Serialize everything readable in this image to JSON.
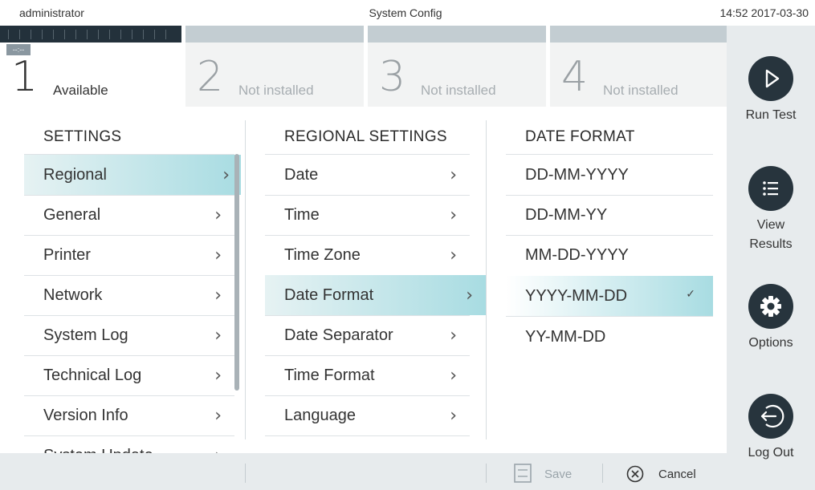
{
  "topbar": {
    "user": "administrator",
    "title": "System Config",
    "clock": "14:52 2017-03-30"
  },
  "modules": [
    {
      "number": "1",
      "status": "Available",
      "indicator": "--:--"
    },
    {
      "number": "2",
      "status": "Not installed"
    },
    {
      "number": "3",
      "status": "Not installed"
    },
    {
      "number": "4",
      "status": "Not installed"
    }
  ],
  "sidebar": {
    "run_test": "Run Test",
    "view_results": "View Results",
    "options": "Options",
    "log_out": "Log Out"
  },
  "settings": {
    "header": "SETTINGS",
    "items": [
      "Regional",
      "General",
      "Printer",
      "Network",
      "System Log",
      "Technical Log",
      "Version Info",
      "System Update"
    ],
    "selected": "Regional"
  },
  "regional": {
    "header": "REGIONAL SETTINGS",
    "items": [
      "Date",
      "Time",
      "Time Zone",
      "Date Format",
      "Date Separator",
      "Time Format",
      "Language"
    ],
    "selected": "Date Format"
  },
  "date_format": {
    "header": "DATE FORMAT",
    "items": [
      "DD-MM-YYYY",
      "DD-MM-YY",
      "MM-DD-YYYY",
      "YYYY-MM-DD",
      "YY-MM-DD"
    ],
    "selected": "YYYY-MM-DD"
  },
  "bottombar": {
    "save": "Save",
    "cancel": "Cancel"
  },
  "colors": {
    "accent": "#a8dce2",
    "dark": "#27343d",
    "panel": "#e7ebed"
  },
  "icons": {
    "run": "play-icon",
    "results": "list-icon",
    "options": "gear-icon",
    "logout": "logout-icon",
    "save": "save-icon",
    "cancel": "cancel-icon"
  }
}
